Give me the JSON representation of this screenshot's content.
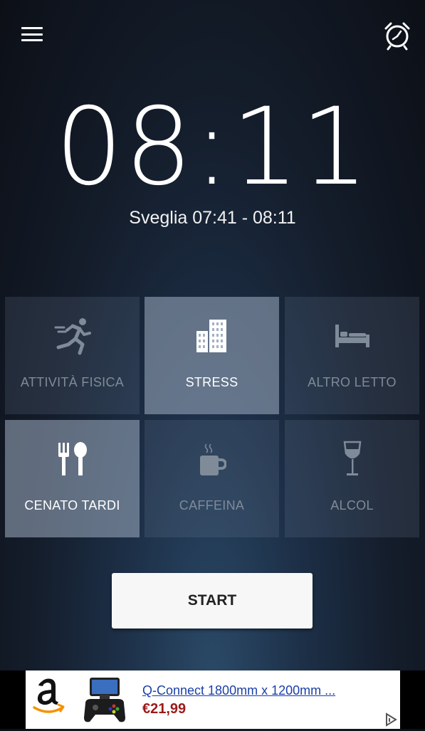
{
  "header": {
    "menu_icon": "hamburger-menu-icon",
    "alarm_icon": "alarm-clock-icon"
  },
  "clock": {
    "time": "08:11",
    "wake_window": "Sveglia 07:41 - 08:11"
  },
  "factors": [
    {
      "label": "ATTIVITÀ FISICA",
      "icon": "running-person-icon",
      "active": false
    },
    {
      "label": "STRESS",
      "icon": "buildings-icon",
      "active": true
    },
    {
      "label": "ALTRO LETTO",
      "icon": "bed-icon",
      "active": false
    },
    {
      "label": "CENATO TARDI",
      "icon": "fork-spoon-icon",
      "active": true
    },
    {
      "label": "CAFFEINA",
      "icon": "coffee-cup-icon",
      "active": false
    },
    {
      "label": "ALCOL",
      "icon": "wine-glass-icon",
      "active": false
    }
  ],
  "start_button": {
    "label": "START"
  },
  "ad": {
    "title": "Q-Connect 1800mm x 1200mm ...",
    "price": "€21,99",
    "brand_icon": "amazon-logo-icon",
    "adchoices_icon": "adchoices-icon"
  },
  "colors": {
    "active_tile": "#a0afc3",
    "inactive_label": "#7f8b98",
    "price": "#9b1a1a",
    "link": "#1a3fa8"
  }
}
